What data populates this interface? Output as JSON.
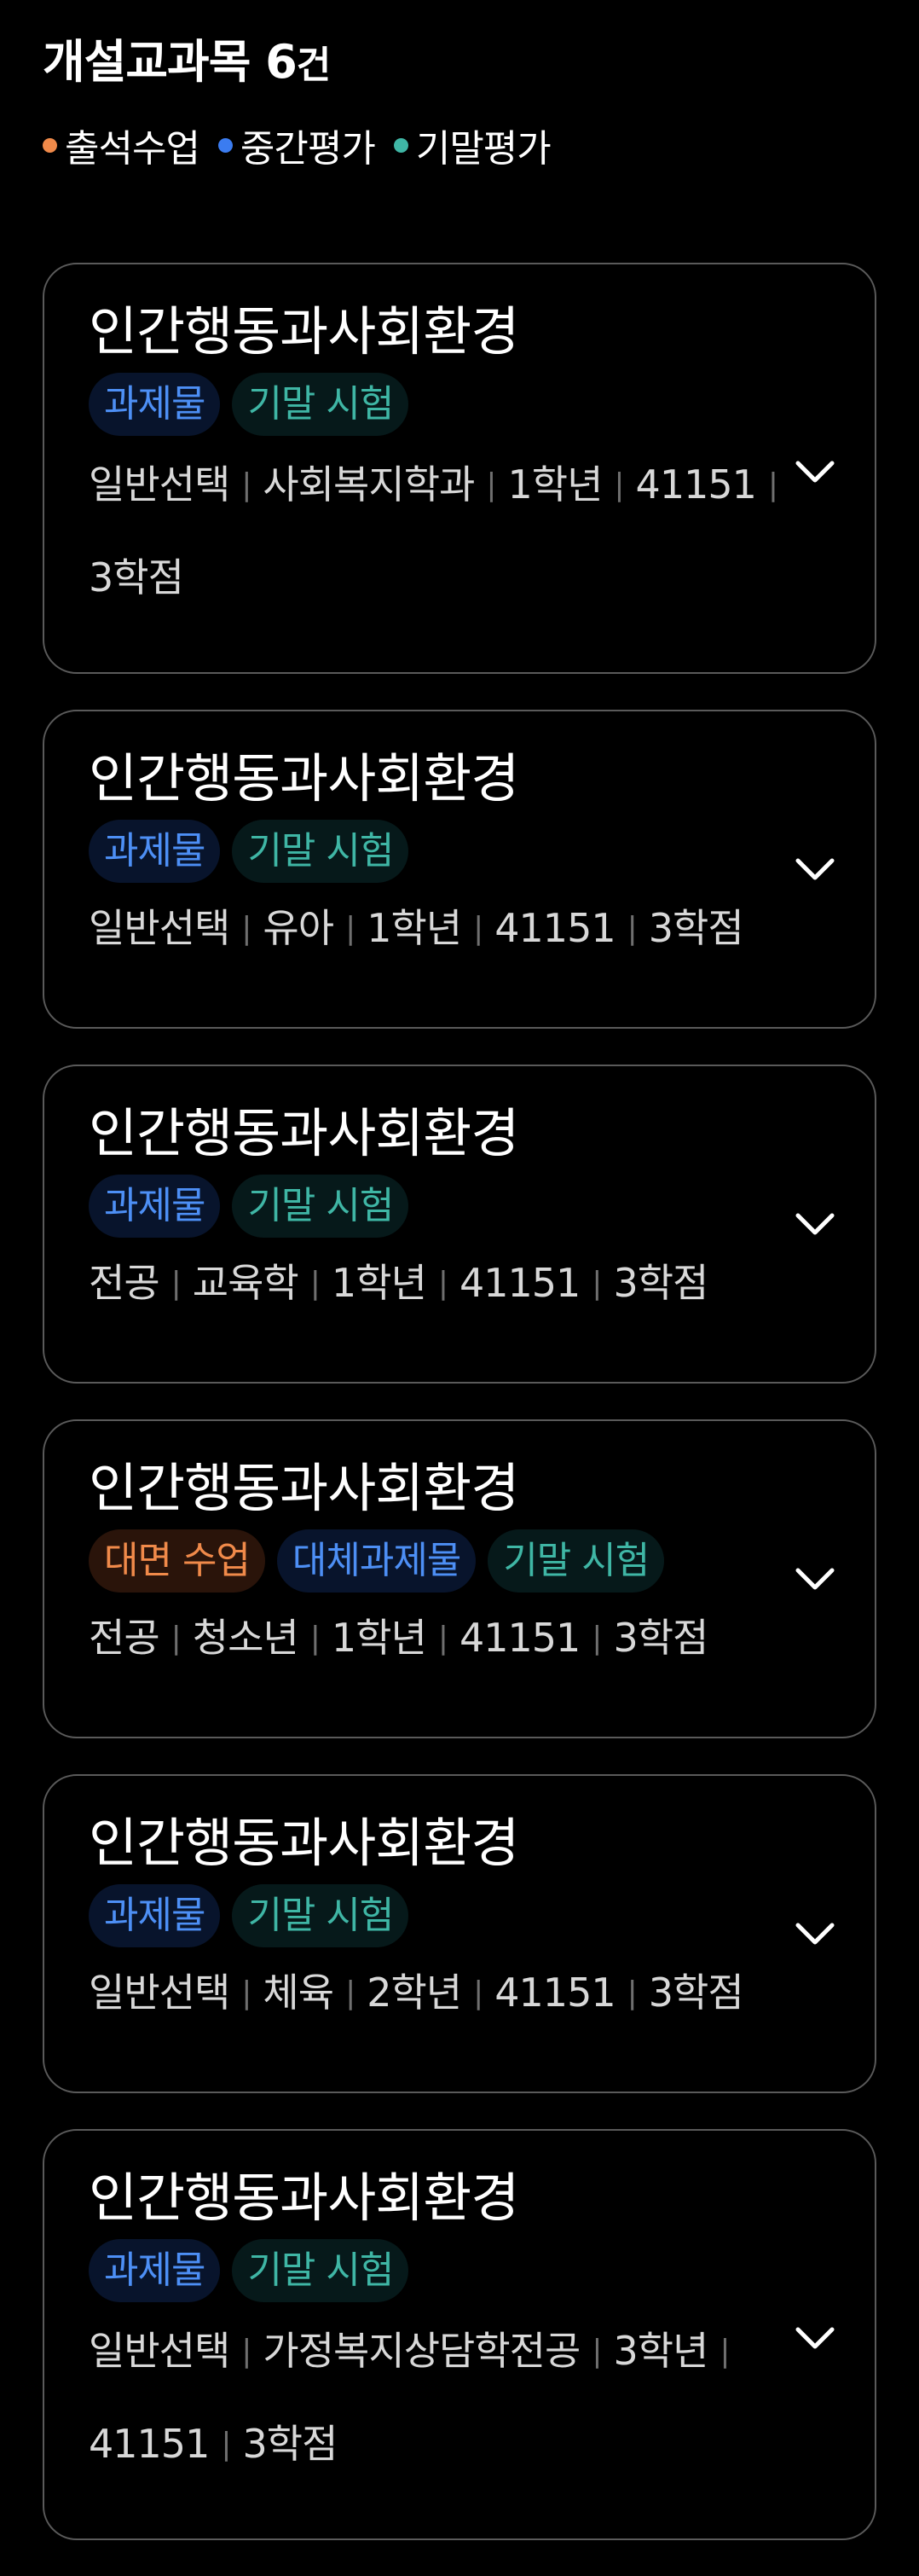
{
  "header": {
    "title_prefix": "개설교과목 ",
    "count": "6",
    "unit": "건"
  },
  "legend": [
    {
      "label": "출석수업",
      "color": "#f08a4a"
    },
    {
      "label": "중간평가",
      "color": "#3b7cf0"
    },
    {
      "label": "기말평가",
      "color": "#3fb6a5"
    }
  ],
  "courses": [
    {
      "title": "인간행동과사회환경",
      "tags": [
        "과제물",
        "기말 시험"
      ],
      "meta": [
        "일반선택",
        "사회복지학과",
        "1학년",
        "41151",
        "3학점"
      ]
    },
    {
      "title": "인간행동과사회환경",
      "tags": [
        "과제물",
        "기말 시험"
      ],
      "meta": [
        "일반선택",
        "유아",
        "1학년",
        "41151",
        "3학점"
      ]
    },
    {
      "title": "인간행동과사회환경",
      "tags": [
        "과제물",
        "기말 시험"
      ],
      "meta": [
        "전공",
        "교육학",
        "1학년",
        "41151",
        "3학점"
      ]
    },
    {
      "title": "인간행동과사회환경",
      "tags": [
        "대면 수업",
        "대체과제물",
        "기말 시험"
      ],
      "meta": [
        "전공",
        "청소년",
        "1학년",
        "41151",
        "3학점"
      ]
    },
    {
      "title": "인간행동과사회환경",
      "tags": [
        "과제물",
        "기말 시험"
      ],
      "meta": [
        "일반선택",
        "체육",
        "2학년",
        "41151",
        "3학점"
      ]
    },
    {
      "title": "인간행동과사회환경",
      "tags": [
        "과제물",
        "기말 시험"
      ],
      "meta": [
        "일반선택",
        "가정복지상담학전공",
        "3학년",
        "41151",
        "3학점"
      ]
    }
  ],
  "icons": {
    "expand": "chevron-down-icon",
    "legend_marker": "dot-icon"
  }
}
